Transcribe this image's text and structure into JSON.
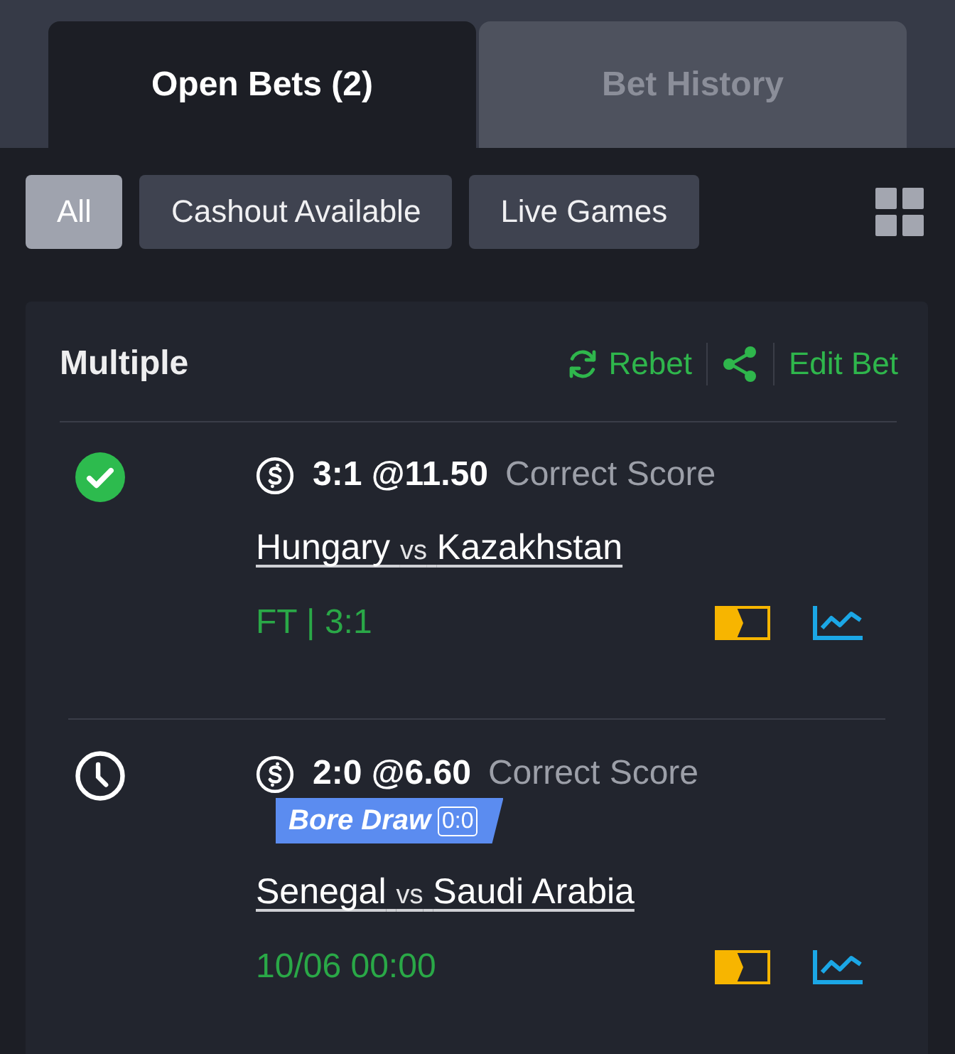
{
  "tabs": [
    {
      "label": "Open Bets (2)",
      "selected": true
    },
    {
      "label": "Bet History",
      "selected": false
    }
  ],
  "filters": [
    {
      "label": "All",
      "selected": true
    },
    {
      "label": "Cashout Available",
      "selected": false
    },
    {
      "label": "Live Games",
      "selected": false
    }
  ],
  "bet": {
    "title": "Multiple",
    "actions": [
      {
        "kind": "rebet",
        "label": "Rebet"
      },
      {
        "kind": "share"
      },
      {
        "kind": "edit",
        "label": "Edit Bet"
      }
    ],
    "legs": [
      {
        "kind": "won",
        "selection": "3:1 @11.50",
        "market": "Correct Score",
        "home": "Hungary",
        "vs": "vs",
        "away": "Kazakhstan",
        "info": "FT | 3:1"
      },
      {
        "kind": "pending",
        "selection": "2:0 @6.60",
        "market": "Correct Score",
        "badge": {
          "label": "Bore Draw",
          "score": "0:0"
        },
        "home": "Senegal",
        "vs": "vs",
        "away": "Saudi Arabia",
        "info": "10/06 00:00"
      }
    ]
  }
}
